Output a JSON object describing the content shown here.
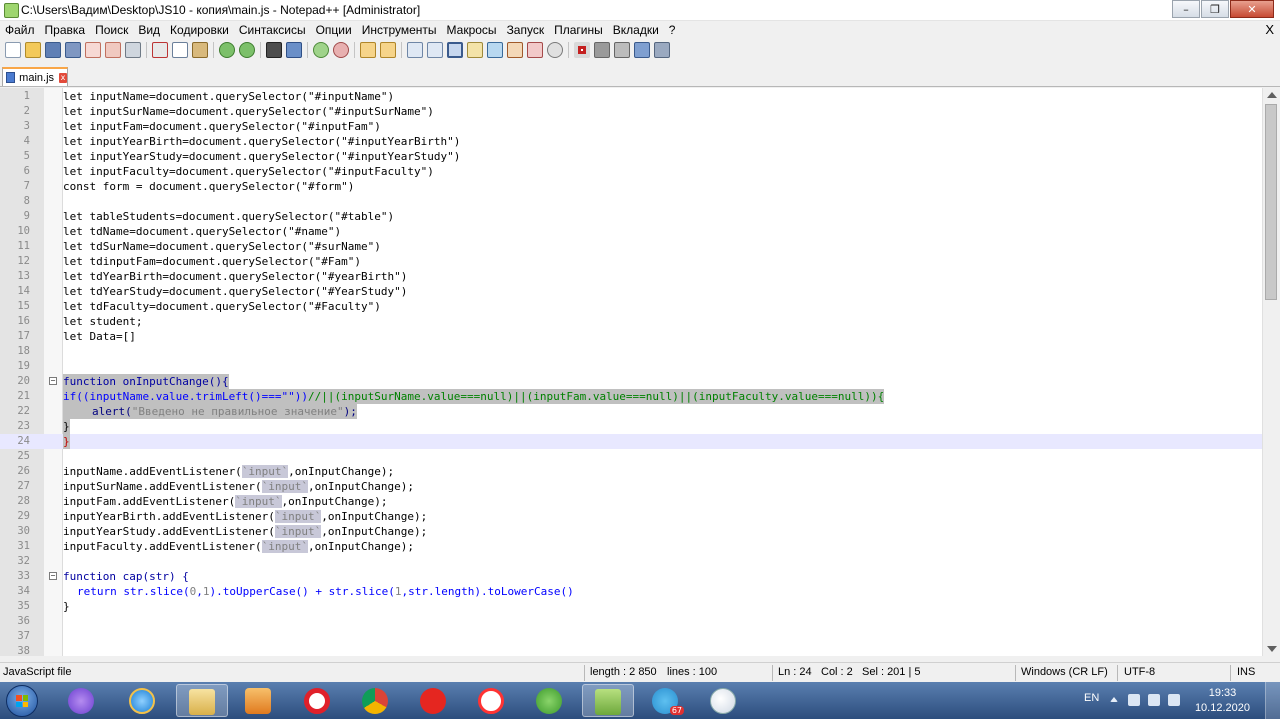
{
  "window": {
    "title": "C:\\Users\\Вадим\\Desktop\\JS10 - копия\\main.js - Notepad++ [Administrator]",
    "minimize_glyph": "–",
    "restore_glyph": "❐",
    "close_glyph": "✕"
  },
  "menu": {
    "items": [
      "Файл",
      "Правка",
      "Поиск",
      "Вид",
      "Кодировки",
      "Синтаксисы",
      "Опции",
      "Инструменты",
      "Макросы",
      "Запуск",
      "Плагины",
      "Вкладки",
      "?"
    ],
    "close_glyph": "X"
  },
  "tab": {
    "label": "main.js",
    "close_glyph": "x"
  },
  "status": {
    "lang": "JavaScript file",
    "length": "length : 2 850",
    "lines": "lines : 100",
    "ln": "Ln : 24",
    "col": "Col : 2",
    "sel": "Sel : 201 | 5",
    "eol": "Windows (CR LF)",
    "encoding": "UTF-8",
    "mode": "INS"
  },
  "taskbar": {
    "lang": "EN",
    "time": "19:33",
    "date": "10.12.2020",
    "telegram_badge": "67"
  },
  "code": {
    "l1": "let inputName=document.querySelector(\"#inputName\")",
    "l2": "let inputSurName=document.querySelector(\"#inputSurName\")",
    "l3": "let inputFam=document.querySelector(\"#inputFam\")",
    "l4": "let inputYearBirth=document.querySelector(\"#inputYearBirth\")",
    "l5": "let inputYearStudy=document.querySelector(\"#inputYearStudy\")",
    "l6": "let inputFaculty=document.querySelector(\"#inputFaculty\")",
    "l7": "const form = document.querySelector(\"#form\")",
    "l9": "let tableStudents=document.querySelector(\"#table\")",
    "l10": "let tdName=document.querySelector(\"#name\")",
    "l11": "let tdSurName=document.querySelector(\"#surName\")",
    "l12": "let tdinputFam=document.querySelector(\"#Fam\")",
    "l13": "let tdYearBirth=document.querySelector(\"#yearBirth\")",
    "l14": "let tdYearStudy=document.querySelector(\"#YearStudy\")",
    "l15": "let tdFaculty=document.querySelector(\"#Faculty\")",
    "l16": "let student;",
    "l17": "let Data=[]",
    "l20": "function onInputChange(){",
    "l21a": "if((inputName.value.trimLeft()===\"\"))",
    "l21b": "//||(inputSurName.value===null)||(inputFam.value===null)||(inputFaculty.value===null)){",
    "l22a": "alert(",
    "l22b": "\"Введено не правильное значение\"",
    "l22c": ");",
    "l23": "}",
    "l24": "}",
    "l26a": "inputName.addEventListener(",
    "l27a": "inputSurName.addEventListener(",
    "l28a": "inputFam.addEventListener(",
    "l29a": "inputYearBirth.addEventListener(",
    "l30a": "inputYearStudy.addEventListener(",
    "l31a": "inputFaculty.addEventListener(",
    "tpl_input": "`input`",
    "listener_tail": ",onInputChange);",
    "l33": "function cap(str) {",
    "l34a": "return str.slice(",
    "l34b": "0",
    "l34c": ",",
    "l34d": "1",
    "l34e": ").toUpperCase() + str.slice(",
    "l34f": "1",
    "l34g": ",str.length).toLowerCase()",
    "l35": "}"
  },
  "line_numbers": [
    "1",
    "2",
    "3",
    "4",
    "5",
    "6",
    "7",
    "8",
    "9",
    "10",
    "11",
    "12",
    "13",
    "14",
    "15",
    "16",
    "17",
    "18",
    "19",
    "20",
    "21",
    "22",
    "23",
    "24",
    "25",
    "26",
    "27",
    "28",
    "29",
    "30",
    "31",
    "32",
    "33",
    "34",
    "35",
    "36",
    "37",
    "38"
  ]
}
